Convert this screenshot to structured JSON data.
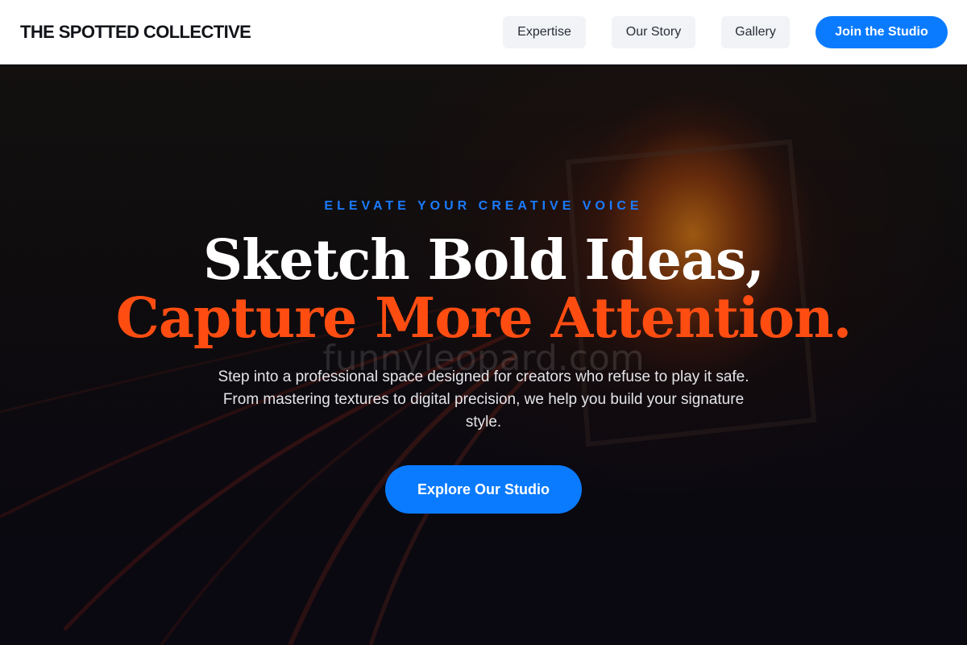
{
  "brand": {
    "name": "THE SPOTTED COLLECTIVE"
  },
  "nav": {
    "links": [
      "Expertise",
      "Our Story",
      "Gallery"
    ],
    "cta": "Join the Studio"
  },
  "hero": {
    "eyebrow": "ELEVATE YOUR CREATIVE VOICE",
    "headline_line1": "Sketch Bold Ideas,",
    "headline_line2": "Capture More Attention.",
    "watermark": "funnyleopard.com",
    "description": "Step into a professional space designed for creators who refuse to play it safe. From mastering textures to digital precision, we help you build your signature style.",
    "cta": "Explore Our Studio"
  },
  "colors": {
    "accent_blue": "#0a7bff",
    "accent_orange": "#ff4d12",
    "header_bg": "#ffffff",
    "hero_bg": "#0c0a12"
  }
}
